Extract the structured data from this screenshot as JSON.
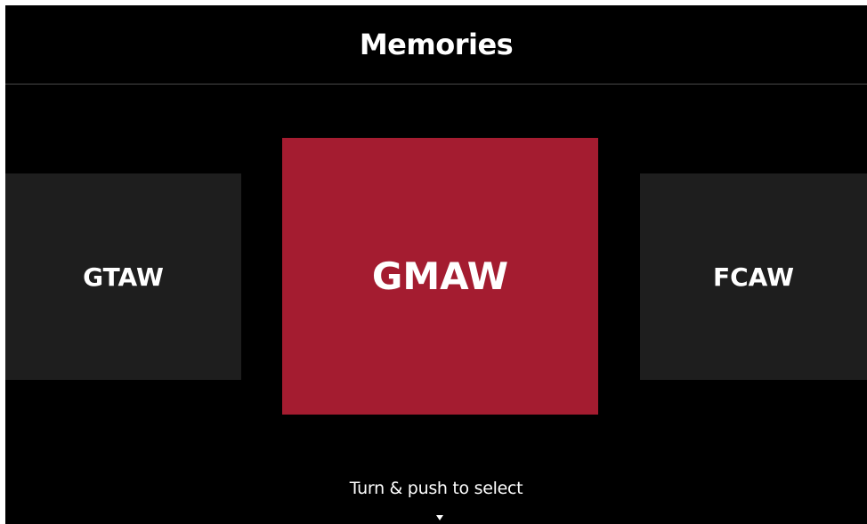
{
  "header": {
    "title": "Memories"
  },
  "carousel": {
    "items": [
      {
        "label": "GTAW",
        "selected": false
      },
      {
        "label": "GMAW",
        "selected": true
      },
      {
        "label": "FCAW",
        "selected": false
      }
    ]
  },
  "footer": {
    "hint": "Turn & push to select",
    "indicator_icon": "triangle-down-icon"
  },
  "colors": {
    "background": "#000000",
    "selected_tile": "#a41c30",
    "unselected_tile": "#1e1e1e",
    "text": "#ffffff"
  }
}
